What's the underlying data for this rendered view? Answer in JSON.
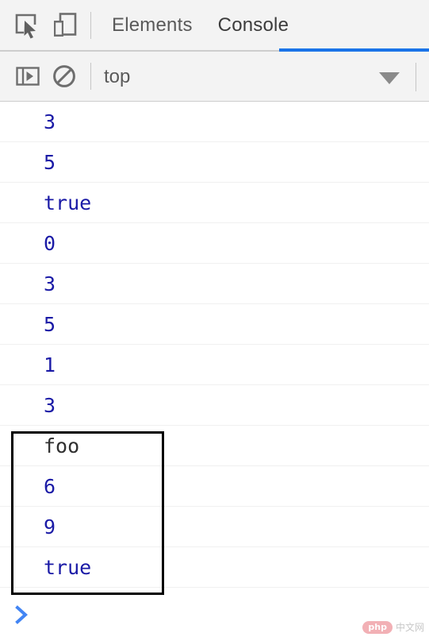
{
  "toolbar": {
    "inspect_icon": "inspect-element-icon",
    "device_icon": "device-toolbar-icon",
    "tabs": [
      {
        "label": "Elements",
        "active": false
      },
      {
        "label": "Console",
        "active": true
      }
    ]
  },
  "filterbar": {
    "sidebar_icon": "console-sidebar-icon",
    "clear_icon": "clear-console-icon",
    "context_value": "top",
    "caret_icon": "chevron-down-icon"
  },
  "console": {
    "rows": [
      {
        "text": "3",
        "kind": "num"
      },
      {
        "text": "5",
        "kind": "num"
      },
      {
        "text": "true",
        "kind": "bool"
      },
      {
        "text": "0",
        "kind": "num"
      },
      {
        "text": "3",
        "kind": "num"
      },
      {
        "text": "5",
        "kind": "num"
      },
      {
        "text": "1",
        "kind": "num"
      },
      {
        "text": "3",
        "kind": "num"
      },
      {
        "text": "foo",
        "kind": "string"
      },
      {
        "text": "6",
        "kind": "num"
      },
      {
        "text": "9",
        "kind": "num"
      },
      {
        "text": "true",
        "kind": "bool"
      }
    ],
    "highlight": {
      "from_row": 8,
      "to_row": 11,
      "color": "#000000"
    },
    "prompt_icon": "prompt-chevron-icon",
    "prompt_color": "#4285f4"
  },
  "watermark": {
    "badge": "php",
    "text": "中文网"
  },
  "colors": {
    "accent": "#1a73e8",
    "value_blue": "#1a1aa6",
    "toolbar_bg": "#f3f3f3"
  }
}
